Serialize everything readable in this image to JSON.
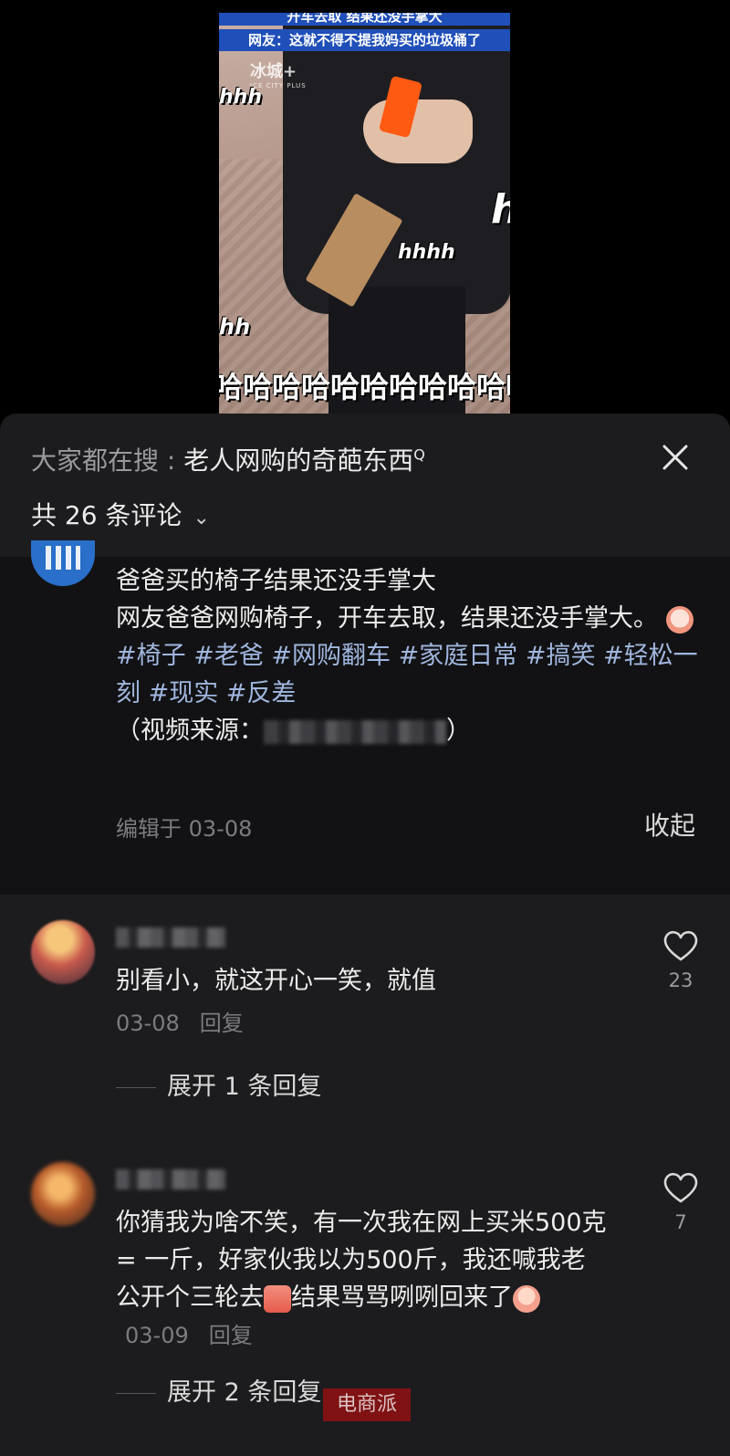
{
  "video": {
    "caption_line1": "开车去取 结果还没手掌大",
    "caption_line2": "网友：这就不得不提我妈买的垃圾桶了",
    "watermark": "冰城+",
    "watermark_sub": "ICE CITY PLUS",
    "laugh_overlays": [
      "hhh",
      "h",
      "hhhh",
      "hh"
    ],
    "haha_line": "哈哈哈哈哈哈哈哈哈哈哈哈"
  },
  "header": {
    "search_prefix": "大家都在搜 : ",
    "search_keyword": "老人网购的奇葩东西",
    "search_glyph": "Q",
    "comment_count_label": "共 26 条评论",
    "close_icon": "close-icon"
  },
  "post": {
    "title": "爸爸买的椅子结果还没手掌大",
    "body": "网友爸爸网购椅子，开车去取，结果还没手掌大。",
    "tags": "#椅子 #老爸 #网购翻车 #家庭日常 #搞笑 #轻松一刻 #现实 #反差",
    "source_prefix": "（视频来源：",
    "source_suffix": "）",
    "edited": "编辑于 03-08",
    "collapse_label": "收起"
  },
  "comments": [
    {
      "text": "别看小，就这开心一笑，就值",
      "date": "03-08",
      "reply_label": "回复",
      "likes": "23",
      "expand_label": "展开 1 条回复"
    },
    {
      "text_part1": "你猜我为啥不笑，有一次我在网上买米500克 = 一斤，好家伙我以为500斤，我还喊我老公开个三轮去",
      "text_part2": "结果骂骂咧咧回来了",
      "date": "03-09",
      "reply_label": "回复",
      "likes": "7",
      "expand_label": "展开 2 条回复"
    }
  ],
  "brand_mark": "电商派"
}
